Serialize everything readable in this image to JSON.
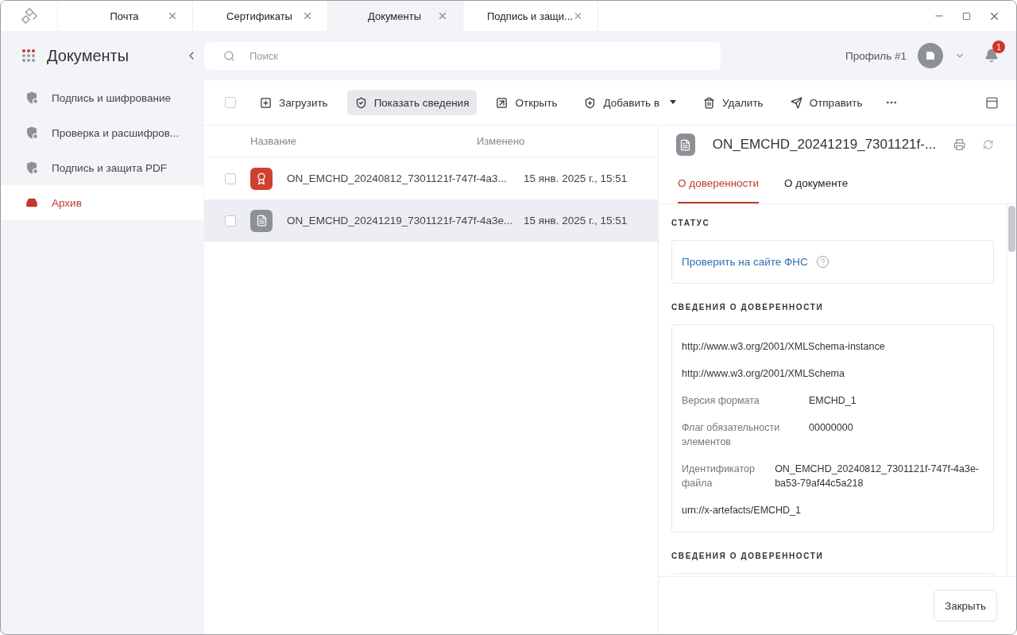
{
  "tabs": [
    {
      "label": "Почта",
      "selected": false
    },
    {
      "label": "Сертификаты",
      "selected": false
    },
    {
      "label": "Документы",
      "selected": true
    },
    {
      "label": "Подпись и защи...",
      "selected": false
    }
  ],
  "sidebar": {
    "title": "Документы",
    "items": [
      {
        "label": "Подпись и шифрование",
        "selected": false
      },
      {
        "label": "Проверка и расшифров...",
        "selected": false
      },
      {
        "label": "Подпись и защита PDF",
        "selected": false
      },
      {
        "label": "Архив",
        "selected": true
      }
    ]
  },
  "search": {
    "placeholder": "Поиск"
  },
  "profile": {
    "name": "Профиль #1",
    "notifications": "1"
  },
  "toolbar": {
    "checked": false,
    "buttons": [
      {
        "label": "Загрузить",
        "selected": false
      },
      {
        "label": "Показать сведения",
        "selected": true
      },
      {
        "label": "Открыть",
        "selected": false
      },
      {
        "label": "Добавить в",
        "selected": false
      },
      {
        "label": "Удалить",
        "selected": false
      },
      {
        "label": "Отправить",
        "selected": false
      }
    ]
  },
  "table": {
    "columns": [
      "Название",
      "Изменено"
    ],
    "rows": [
      {
        "kind": "certificate",
        "name": "ON_EMCHD_20240812_7301121f-747f-4a3...",
        "modified": "15 янв. 2025 г., 15:51",
        "selected": false,
        "checked": false
      },
      {
        "kind": "document",
        "name": "ON_EMCHD_20241219_7301121f-747f-4a3e...",
        "modified": "15 янв. 2025 г., 15:51",
        "selected": true,
        "checked": false
      }
    ]
  },
  "details": {
    "title": "ON_EMCHD_20241219_7301121f-...",
    "tabs": [
      {
        "label": "О доверенности",
        "selected": true
      },
      {
        "label": "О документе",
        "selected": false
      }
    ],
    "sections": [
      {
        "heading": "СТАТУС",
        "link": "Проверить на сайте ФНС"
      },
      {
        "heading": "СВЕДЕНИЯ О ДОВЕРЕННОСТИ",
        "fields": [
          {
            "kind": "text",
            "value": "http://www.w3.org/2001/XMLSchema-instance"
          },
          {
            "kind": "text",
            "value": "http://www.w3.org/2001/XMLSchema"
          },
          {
            "kind": "pair",
            "label": "Версия формата",
            "value": "EMCHD_1"
          },
          {
            "kind": "pair",
            "label": "Флаг обязательности элементов",
            "value": "00000000"
          },
          {
            "kind": "pair",
            "label": "Идентификатор файла",
            "value": "ON_EMCHD_20240812_7301121f-747f-4a3e-ba53-79af44c5a218"
          },
          {
            "kind": "text",
            "value": "urn://x-artefacts/EMCHD_1"
          }
        ]
      },
      {
        "heading": "СВЕДЕНИЯ О ДОВЕРЕННОСТИ"
      }
    ],
    "close_button": "Закрыть"
  }
}
